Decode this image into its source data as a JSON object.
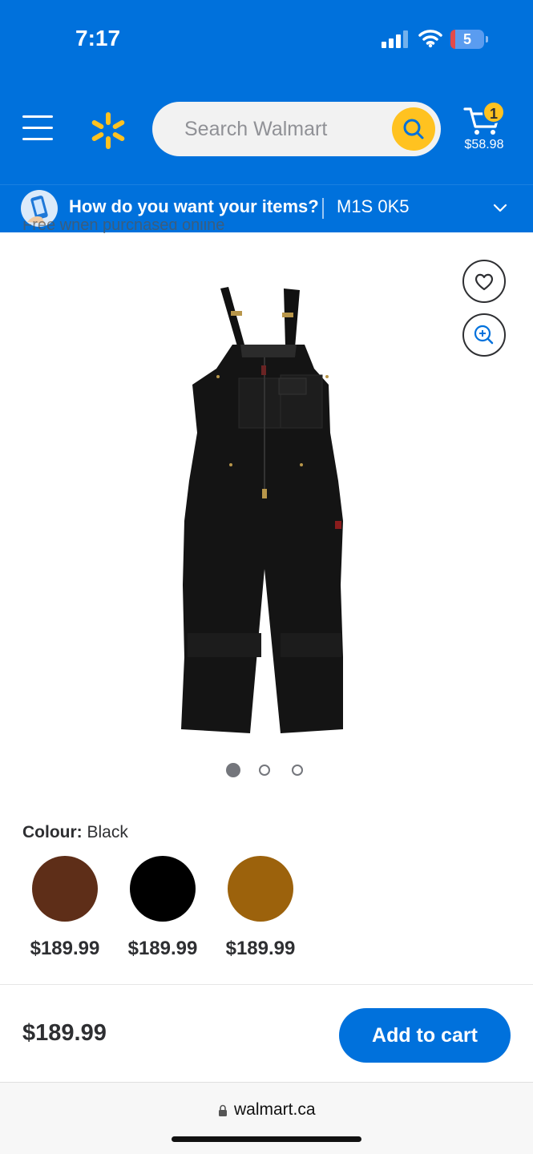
{
  "status_bar": {
    "time": "7:17",
    "battery": "5"
  },
  "header": {
    "search_placeholder": "Search Walmart",
    "cart_count": "1",
    "cart_total": "$58.98"
  },
  "delivery": {
    "question": "How do you want your items?",
    "postal_code": "M1S 0K5"
  },
  "partial_text": "Free when purchased online",
  "carousel": {
    "total": 3,
    "active": 0
  },
  "colour": {
    "label": "Colour:",
    "selected": "Black",
    "options": [
      {
        "color": "#5e2e18",
        "price": "$189.99"
      },
      {
        "color": "#000000",
        "price": "$189.99"
      },
      {
        "color": "#9c620c",
        "price": "$189.99"
      }
    ]
  },
  "bottom_bar": {
    "price": "$189.99",
    "add_to_cart": "Add to cart"
  },
  "browser": {
    "url": "walmart.ca"
  },
  "colors": {
    "brand_blue": "#0071dc",
    "spark_yellow": "#ffc220"
  }
}
